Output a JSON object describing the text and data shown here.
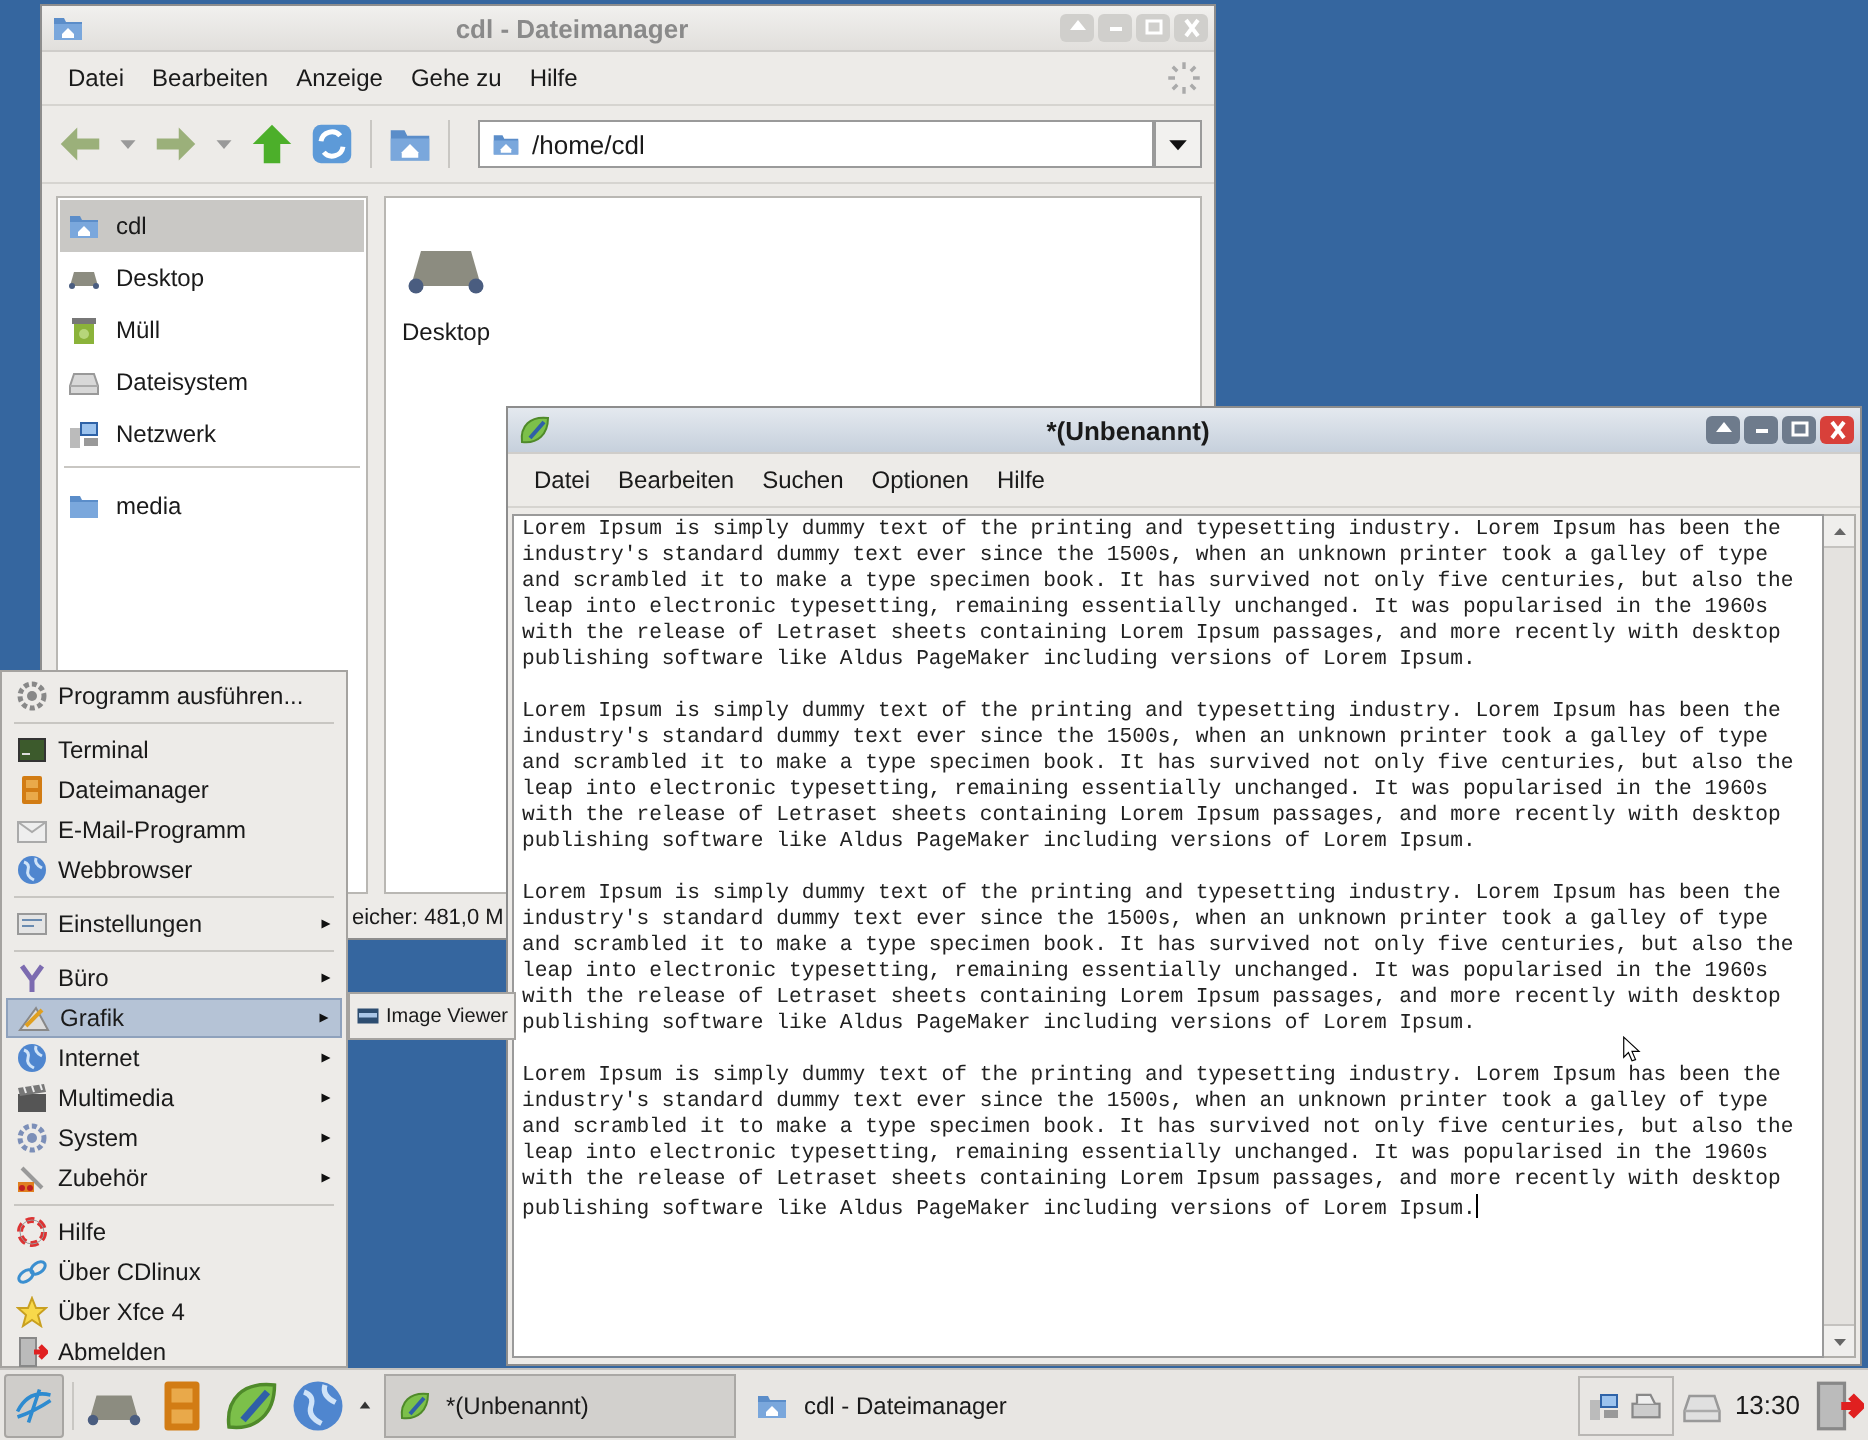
{
  "file_manager": {
    "title": "cdl - Dateimanager",
    "active": false,
    "menu": [
      "Datei",
      "Bearbeiten",
      "Anzeige",
      "Gehe zu",
      "Hilfe"
    ],
    "location": "/home/cdl",
    "places": [
      {
        "label": "cdl",
        "selected": true
      },
      {
        "label": "Desktop",
        "selected": false
      },
      {
        "label": "Müll",
        "selected": false
      },
      {
        "label": "Dateisystem",
        "selected": false
      },
      {
        "label": "Netzwerk",
        "selected": false
      }
    ],
    "devices": [
      {
        "label": "media",
        "selected": false
      }
    ],
    "items": [
      {
        "label": "Desktop",
        "selected": false
      }
    ],
    "status": "eicher: 481,0 M"
  },
  "editor": {
    "title": "*(Unbenannt)",
    "active": true,
    "menu": [
      "Datei",
      "Bearbeiten",
      "Suchen",
      "Optionen",
      "Hilfe"
    ],
    "paragraphs": [
      "Lorem Ipsum is simply dummy text of the printing and typesetting industry. Lorem Ipsum has been the industry's standard dummy text ever since the 1500s, when an unknown printer took a galley of type and scrambled it to make a type specimen book. It has survived not only five centuries, but also the leap into electronic typesetting, remaining essentially unchanged. It was popularised in the 1960s with the release of Letraset sheets containing Lorem Ipsum passages, and more recently with desktop publishing software like Aldus PageMaker including versions of Lorem Ipsum.",
      "Lorem Ipsum is simply dummy text of the printing and typesetting industry. Lorem Ipsum has been the industry's standard dummy text ever since the 1500s, when an unknown printer took a galley of type and scrambled it to make a type specimen book. It has survived not only five centuries, but also the leap into electronic typesetting, remaining essentially unchanged. It was popularised in the 1960s with the release of Letraset sheets containing Lorem Ipsum passages, and more recently with desktop publishing software like Aldus PageMaker including versions of Lorem Ipsum.",
      "Lorem Ipsum is simply dummy text of the printing and typesetting industry. Lorem Ipsum has been the industry's standard dummy text ever since the 1500s, when an unknown printer took a galley of type and scrambled it to make a type specimen book. It has survived not only five centuries, but also the leap into electronic typesetting, remaining essentially unchanged. It was popularised in the 1960s with the release of Letraset sheets containing Lorem Ipsum passages, and more recently with desktop publishing software like Aldus PageMaker including versions of Lorem Ipsum.",
      "Lorem Ipsum is simply dummy text of the printing and typesetting industry. Lorem Ipsum has been the industry's standard dummy text ever since the 1500s, when an unknown printer took a galley of type and scrambled it to make a type specimen book. It has survived not only five centuries, but also the leap into electronic typesetting, remaining essentially unchanged. It was popularised in the 1960s with the release of Letraset sheets containing Lorem Ipsum passages, and more recently with desktop publishing software like Aldus PageMaker including versions of Lorem Ipsum."
    ]
  },
  "start_menu": {
    "sections": [
      [
        {
          "label": "Programm ausführen...",
          "submenu": false,
          "selected": false
        }
      ],
      [
        {
          "label": "Terminal",
          "submenu": false,
          "selected": false
        },
        {
          "label": "Dateimanager",
          "submenu": false,
          "selected": false
        },
        {
          "label": "E-Mail-Programm",
          "submenu": false,
          "selected": false
        },
        {
          "label": "Webbrowser",
          "submenu": false,
          "selected": false
        }
      ],
      [
        {
          "label": "Einstellungen",
          "submenu": true,
          "selected": false
        }
      ],
      [
        {
          "label": "Büro",
          "submenu": true,
          "selected": false
        },
        {
          "label": "Grafik",
          "submenu": true,
          "selected": true
        },
        {
          "label": "Internet",
          "submenu": true,
          "selected": false
        },
        {
          "label": "Multimedia",
          "submenu": true,
          "selected": false
        },
        {
          "label": "System",
          "submenu": true,
          "selected": false
        },
        {
          "label": "Zubehör",
          "submenu": true,
          "selected": false
        }
      ],
      [
        {
          "label": "Hilfe",
          "submenu": false,
          "selected": false
        },
        {
          "label": "Über CDlinux",
          "submenu": false,
          "selected": false
        },
        {
          "label": "Über Xfce 4",
          "submenu": false,
          "selected": false
        },
        {
          "label": "Abmelden",
          "submenu": false,
          "selected": false
        }
      ]
    ],
    "submenu": [
      {
        "label": "Image Viewer",
        "selected": false
      }
    ]
  },
  "taskbar": {
    "start_selected": true,
    "tasks": [
      {
        "label": "*(Unbenannt)",
        "selected": true
      },
      {
        "label": "cdl - Dateimanager",
        "selected": false
      }
    ],
    "clock": "13:30"
  }
}
